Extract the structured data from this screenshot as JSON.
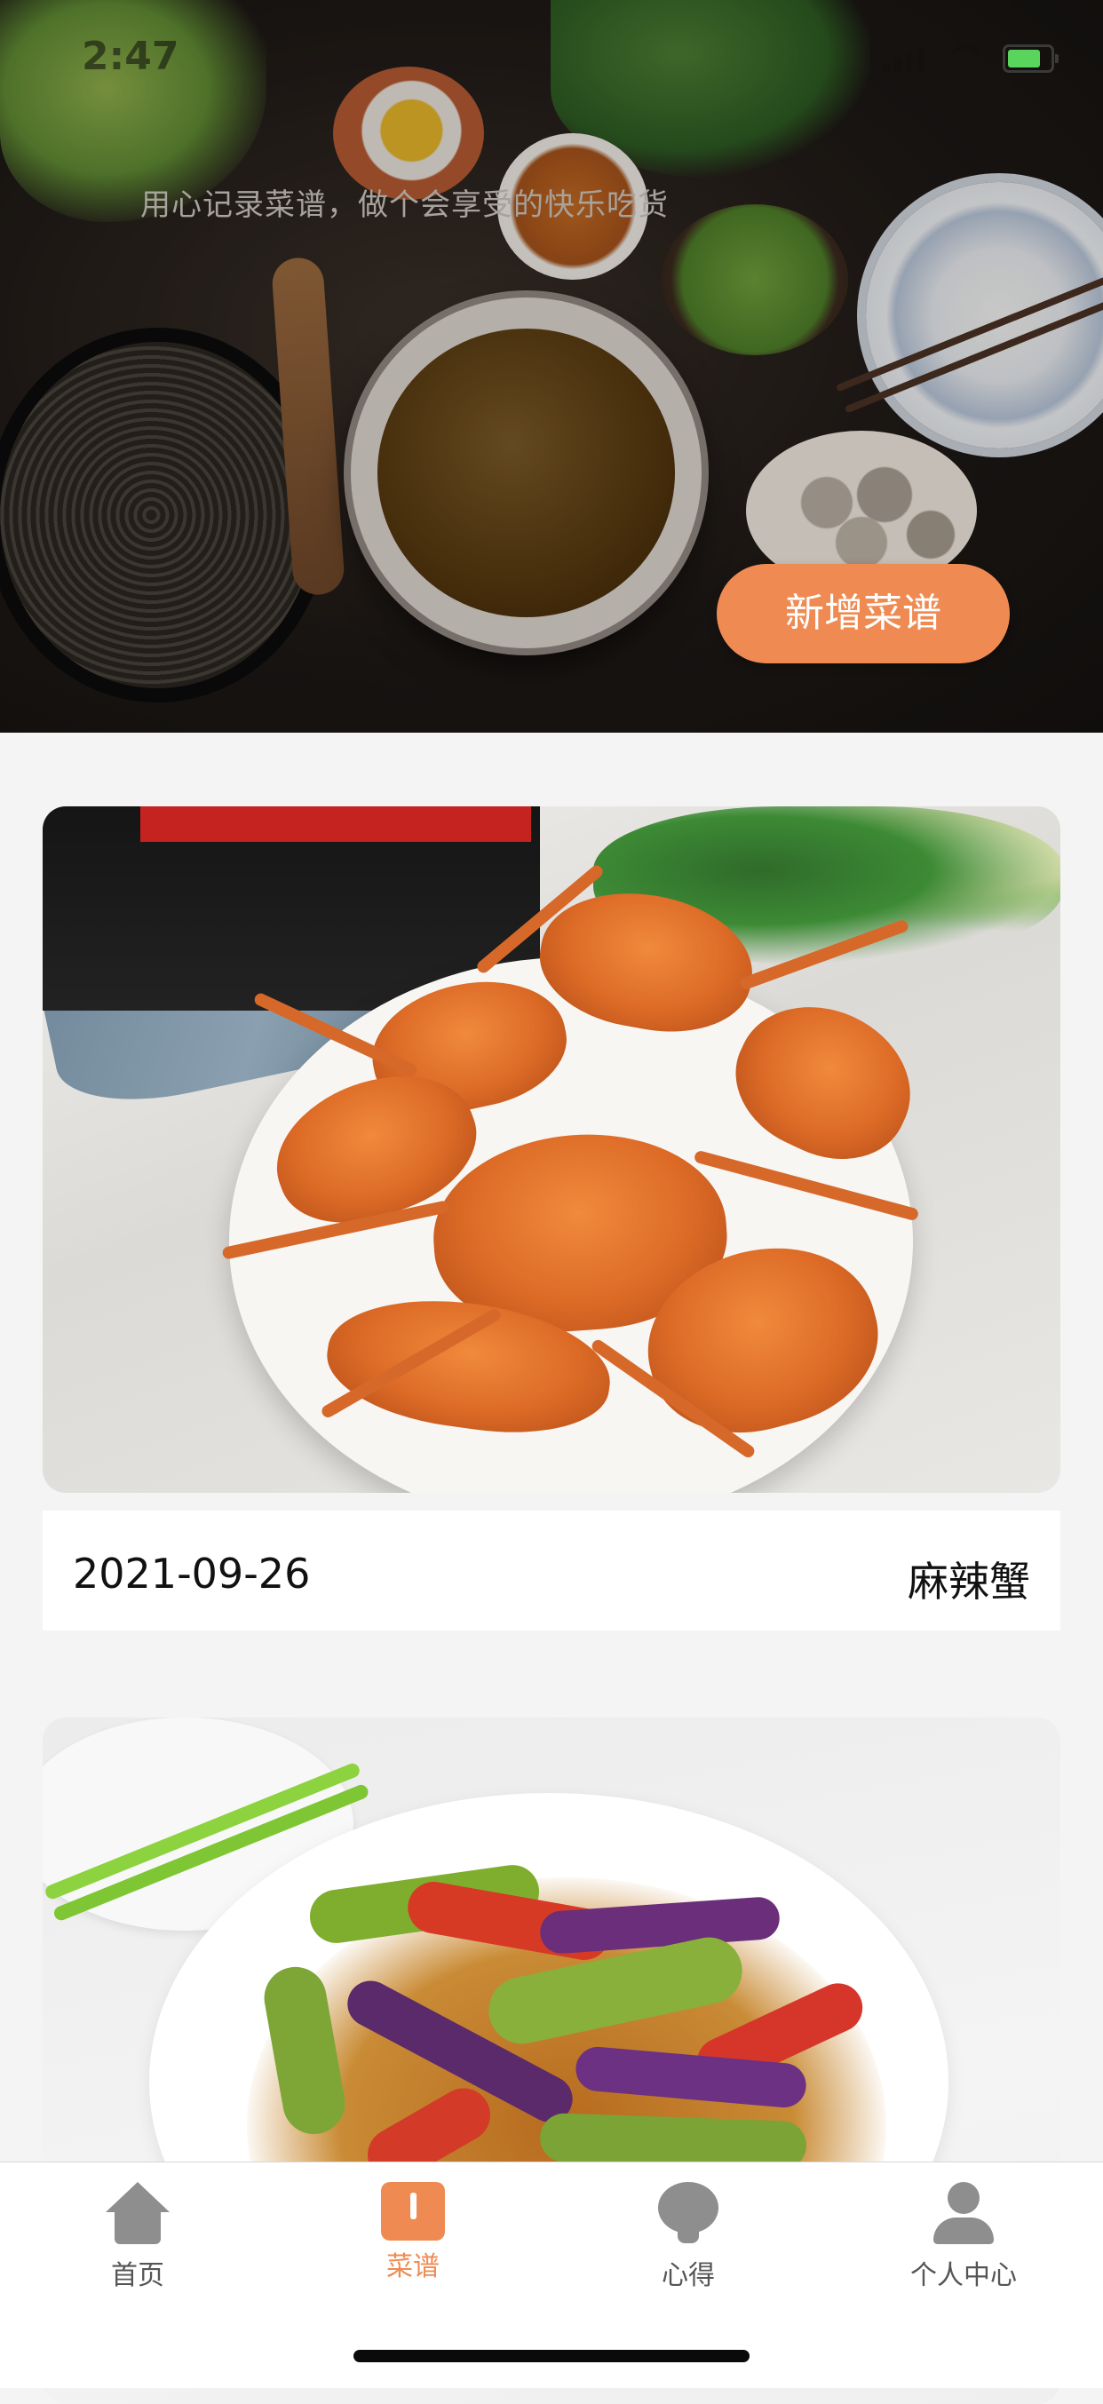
{
  "status_bar": {
    "time": "2:47"
  },
  "header": {
    "tagline": "用心记录菜谱，做个会享受的快乐吃货",
    "add_button_label": "新增菜谱"
  },
  "recipes": [
    {
      "date": "2021-09-26",
      "name": "麻辣蟹"
    },
    {
      "date": "",
      "name": ""
    }
  ],
  "tab_bar": {
    "tabs": [
      {
        "label": "首页",
        "icon": "home-icon",
        "active": false
      },
      {
        "label": "菜谱",
        "icon": "book-icon",
        "active": true
      },
      {
        "label": "心得",
        "icon": "lightbulb-icon",
        "active": false
      },
      {
        "label": "个人中心",
        "icon": "person-icon",
        "active": false
      }
    ],
    "active_color": "#ef8b52",
    "inactive_color": "#8e8e8e"
  }
}
